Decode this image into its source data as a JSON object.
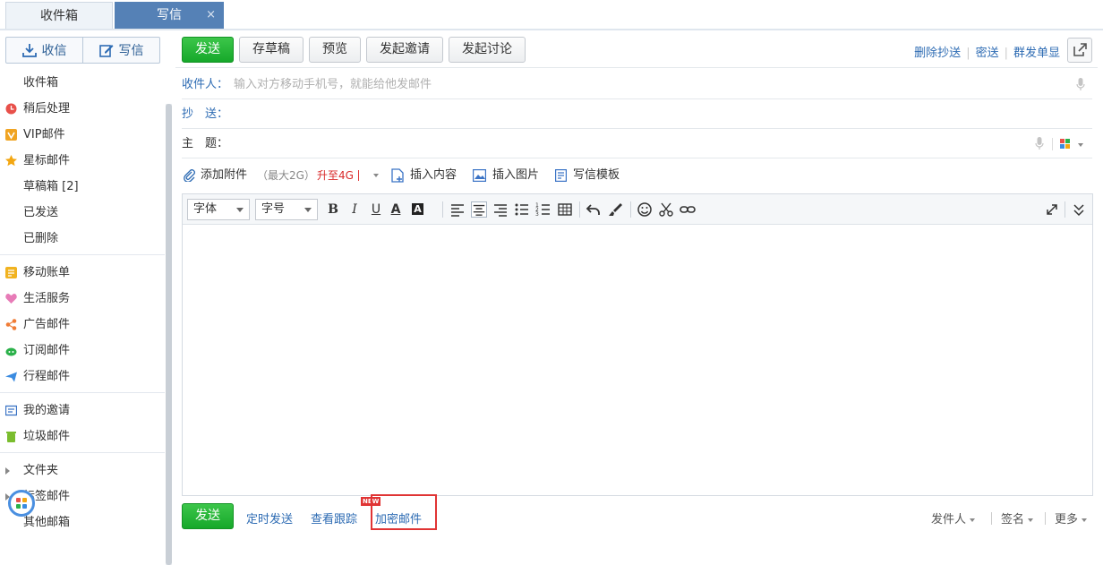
{
  "tabs": {
    "inbox": "收件箱",
    "compose": "写信",
    "close": "×"
  },
  "sidebar": {
    "receive": "收信",
    "compose": "写信",
    "folders": [
      {
        "label": "收件箱",
        "icon": "none"
      },
      {
        "label": "稍后处理",
        "icon": "clock-icon"
      },
      {
        "label": "VIP邮件",
        "icon": "vip-icon"
      },
      {
        "label": "星标邮件",
        "icon": "star-icon"
      },
      {
        "label": "草稿箱 [2]",
        "icon": "none"
      },
      {
        "label": "已发送",
        "icon": "none"
      },
      {
        "label": "已删除",
        "icon": "none"
      }
    ],
    "services": [
      {
        "label": "移动账单",
        "icon": "bill-icon"
      },
      {
        "label": "生活服务",
        "icon": "heart-icon"
      },
      {
        "label": "广告邮件",
        "icon": "share-icon"
      },
      {
        "label": "订阅邮件",
        "icon": "subscribe-icon"
      },
      {
        "label": "行程邮件",
        "icon": "plane-icon"
      }
    ],
    "others": [
      {
        "label": "我的邀请",
        "icon": "invite-icon"
      },
      {
        "label": "垃圾邮件",
        "icon": "trash-icon"
      }
    ],
    "groups": [
      {
        "label": "文件夹"
      },
      {
        "label": "标签邮件"
      },
      {
        "label": "其他邮箱"
      }
    ]
  },
  "toolbar": {
    "send": "发送",
    "save_draft": "存草稿",
    "preview": "预览",
    "invite": "发起邀请",
    "discussion": "发起讨论",
    "delete_cc": "删除抄送",
    "bcc": "密送",
    "group_single": "群发单显"
  },
  "fields": {
    "to_label": "收件人：",
    "to_placeholder": "输入对方移动手机号，就能给他发邮件",
    "cc_label": "抄　送：",
    "subject_label": "主　题："
  },
  "attach": {
    "add": "添加附件",
    "limit": "（最大2G）",
    "upgrade": "升至4G",
    "insert_content": "插入内容",
    "insert_image": "插入图片",
    "template": "写信模板"
  },
  "editor": {
    "font": "字体",
    "size": "字号"
  },
  "bottom": {
    "send": "发送",
    "scheduled": "定时发送",
    "tracking": "查看跟踪",
    "encrypt": "加密邮件",
    "new_badge": "NEW",
    "sender": "发件人",
    "signature": "签名",
    "more": "更多"
  },
  "colors": {
    "accent": "#2d6bb3",
    "send_green": "#16a82a",
    "tab_active": "#5581b6",
    "highlight": "#e03434"
  }
}
